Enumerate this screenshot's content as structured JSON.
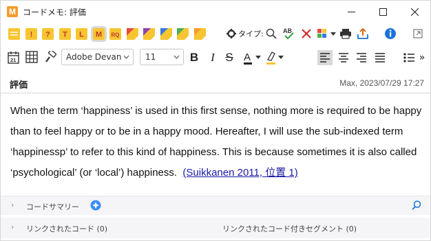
{
  "window": {
    "app_icon_letter": "M",
    "title": "コードメモ: 評価"
  },
  "toolbar": {
    "memo_icons": [
      {
        "name": "memo-icon-plain",
        "glyph": "",
        "color": "#f7c531"
      },
      {
        "name": "memo-icon-exclaim",
        "glyph": "!",
        "color": "#f7c531"
      },
      {
        "name": "memo-icon-question",
        "glyph": "?",
        "color": "#f7c531"
      },
      {
        "name": "memo-icon-t",
        "glyph": "T",
        "color": "#f7c531"
      },
      {
        "name": "memo-icon-l",
        "glyph": "L",
        "color": "#f7c531"
      },
      {
        "name": "memo-icon-m",
        "glyph": "M",
        "color": "#f7c531"
      },
      {
        "name": "memo-icon-rq",
        "glyph": "RQ",
        "color": "#f7c531"
      },
      {
        "name": "memo-icon-red",
        "glyph": "",
        "color": "#e74c3c"
      },
      {
        "name": "memo-icon-purple",
        "glyph": "",
        "color": "#8e44ad"
      },
      {
        "name": "memo-icon-blue",
        "glyph": "",
        "color": "#3a78d8"
      },
      {
        "name": "memo-icon-green",
        "glyph": "",
        "color": "#4caf50"
      },
      {
        "name": "memo-icon-orange",
        "glyph": "",
        "color": "#f39c2b"
      }
    ],
    "type_label": "タイプ:",
    "font_name": "Adobe Devana",
    "font_size": "11"
  },
  "memo": {
    "title": "評価",
    "meta": "Max, 2023/07/29 17:27",
    "text": "When the term ‘happiness’ is used in this first sense, nothing more is required to be happy than to feel happy or to be in a happy mood. Hereafter, I will use the sub-indexed term ‘happinessp’ to refer to this kind of happiness. This is because sometimes it is also called ‘psychological’ (or ‘local’) happiness.",
    "citation": "(Suikkanen 2011, 位置 1)"
  },
  "footer": {
    "code_summary_label": "コードサマリー",
    "linked_codes_label": "リンクされたコード (0)",
    "linked_segments_label": "リンクされたコード付きセグメント (0)"
  },
  "colors": {
    "accent_blue": "#1a73d9",
    "memo_yellow": "#f7c531",
    "link": "#1a1aa6"
  }
}
